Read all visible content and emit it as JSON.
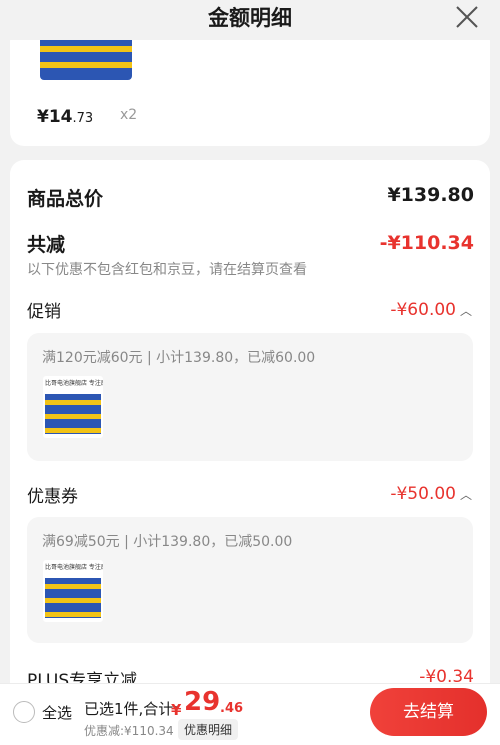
{
  "header": {
    "title": "金额明细",
    "close_icon": "close-icon"
  },
  "item": {
    "price_symbol": "¥",
    "price_int": "14",
    "price_dec": ".73",
    "quantity": "x2"
  },
  "summary": {
    "goods_total_label": "商品总价",
    "goods_total_value": "¥139.80",
    "total_discount_label": "共减",
    "total_discount_value": "-¥110.34",
    "note": "以下优惠不包含红包和京豆，请在结算页查看"
  },
  "promotion": {
    "label": "促销",
    "value": "-¥60.00",
    "detail": "满120元减60元 | 小计139.80，已减60.00"
  },
  "coupon": {
    "label": "优惠券",
    "value": "-¥50.00",
    "detail": "满69减50元 | 小计139.80，已减50.00"
  },
  "plus": {
    "label": "PLUS专享立减",
    "value": "-¥0.34"
  },
  "product_thumb": {
    "caption": "比哥电池旗舰店 专注原装电池 促销"
  },
  "footer": {
    "select_all": "全选",
    "selected_text": "已选1件,合计:",
    "total_symbol": "¥",
    "total_int": "29",
    "total_dec": ".46",
    "discount_text": "优惠减:¥110.34",
    "detail_button": "优惠明细",
    "checkout_button": "去结算"
  },
  "colors": {
    "accent_red": "#e8332e",
    "background": "#f2f2f2"
  }
}
